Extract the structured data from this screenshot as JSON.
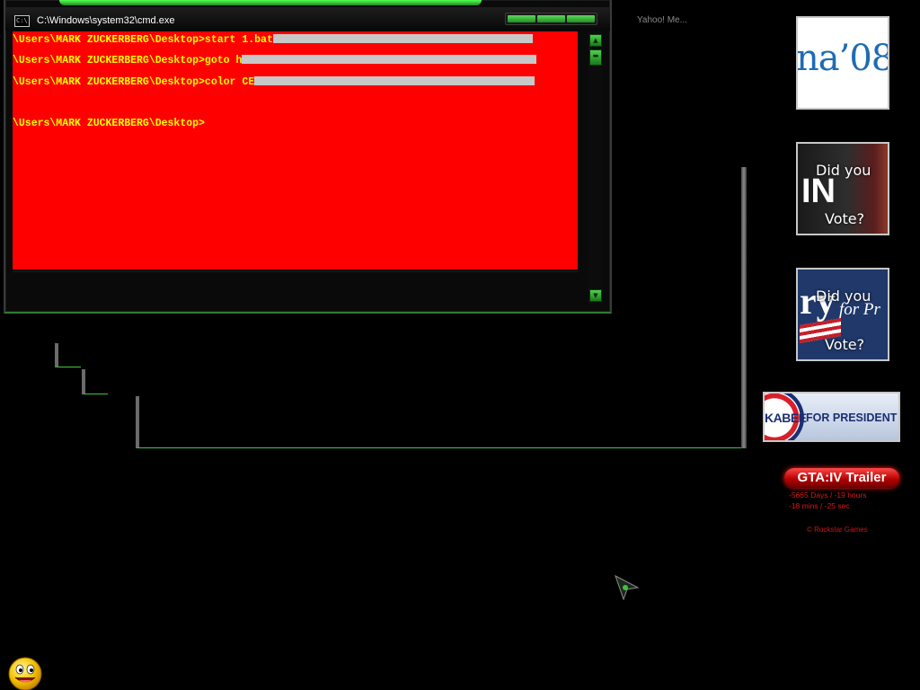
{
  "cmd_window": {
    "title": "C:\\Windows\\system32\\cmd.exe",
    "icon": "cmd-window-icon",
    "controls": [
      "minimize",
      "maximize",
      "close"
    ],
    "colors": {
      "background": "#ff0000",
      "text": "#ffff00",
      "highlight": "#c8c8c8",
      "accent": "#2bbd2b"
    },
    "lines": [
      {
        "text": "\\Users\\MARK ZUCKERBERG\\Desktop>start 1.bat"
      },
      {
        "text": "\\Users\\MARK ZUCKERBERG\\Desktop>goto h"
      },
      {
        "text": "\\Users\\MARK ZUCKERBERG\\Desktop>color CE"
      },
      {
        "text": "\\Users\\MARK ZUCKERBERG\\Desktop>"
      }
    ]
  },
  "yahoo_label": "Yahoo! Me...",
  "tiles": {
    "obama": {
      "logo_text": "na’08"
    },
    "tile2": {
      "logo_text": "IN",
      "caption_1": "Did you",
      "caption_2": "Vote?"
    },
    "tile3": {
      "logo_text_1": "ry",
      "logo_text_2": "for Pr",
      "caption_1": "Did you",
      "caption_2": "Vote?"
    }
  },
  "huckabee": {
    "name": "KABEE",
    "tagline": "FOR PRESIDENT"
  },
  "gta": {
    "button_label": "GTA:IV  Trailer",
    "countdown_line_1": "-5665 Days / -19 hours",
    "countdown_line_2": "-18 mins / -25 sec",
    "credit": "© Rockstar Games"
  },
  "icons": {
    "cursor": "mouse-cursor-icon",
    "smiley": "smiley-icon",
    "scroll_up": "scroll-up-icon",
    "scroll_down": "scroll-down-icon"
  }
}
